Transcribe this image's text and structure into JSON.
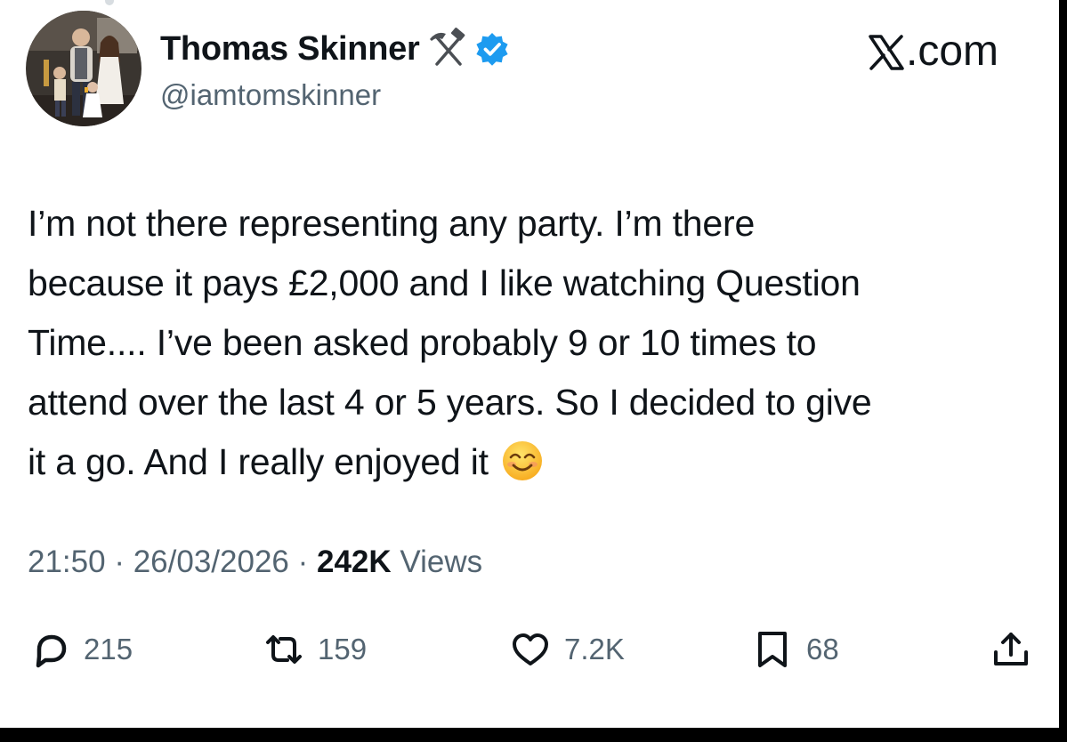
{
  "site": {
    "logo_letter": "𝕏",
    "label": ".com"
  },
  "author": {
    "name": "Thomas Skinner",
    "handle": "@iamtomskinner",
    "badge_icon": "hammer-and-pick-icon",
    "verified_icon": "verified-badge-icon",
    "verified_color": "#1d9bf0"
  },
  "tweet": {
    "lines": [
      "I’m not there representing any party. I’m there",
      "because it pays £2,000 and I like watching Question",
      "Time.... I’ve been asked probably 9 or 10 times to",
      "attend over the last 4 or 5 years. So I decided to give",
      "it a go. And I really enjoyed it"
    ],
    "emoji": "smiling-face-icon"
  },
  "meta": {
    "time": "21:50",
    "sep1": " · ",
    "date": "26/03/2026",
    "sep2": " · ",
    "views_count": "242K",
    "views_label": " Views"
  },
  "actions": {
    "replies": "215",
    "reposts": "159",
    "likes": "7.2K",
    "bookmarks": "68"
  },
  "colors": {
    "text": "#0f1419",
    "secondary": "#536471",
    "background": "#ffffff",
    "frame": "#000000"
  }
}
